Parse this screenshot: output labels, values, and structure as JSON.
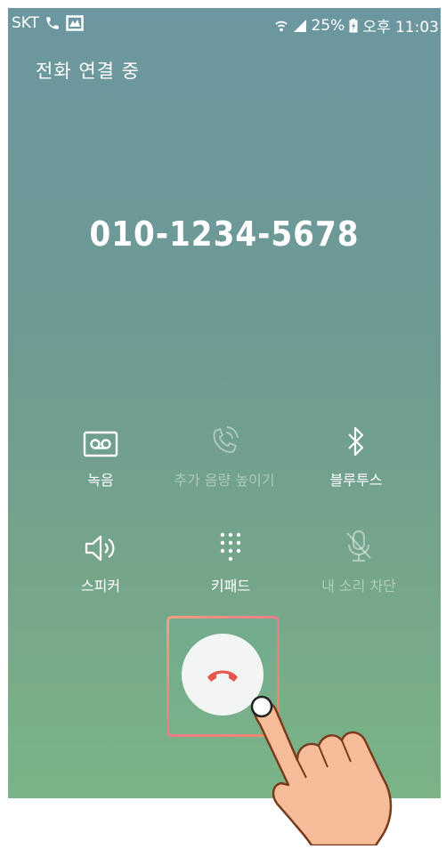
{
  "status_bar": {
    "carrier": "SKT",
    "battery": "25%",
    "time": "오후 11:03"
  },
  "call": {
    "status": "전화 연결 중",
    "number": "010-1234-5678"
  },
  "controls": {
    "record": "녹음",
    "volume_boost": "추가 음량 높이기",
    "bluetooth": "블루투스",
    "speaker": "스피커",
    "keypad": "키패드",
    "mute": "내 소리 차단"
  },
  "icons": {
    "end_call": "phone-hangup-icon",
    "record": "voicemail-icon",
    "speaker": "speaker-icon"
  },
  "colors": {
    "end_call": "#e8574f",
    "frame": "#ef8a80"
  }
}
